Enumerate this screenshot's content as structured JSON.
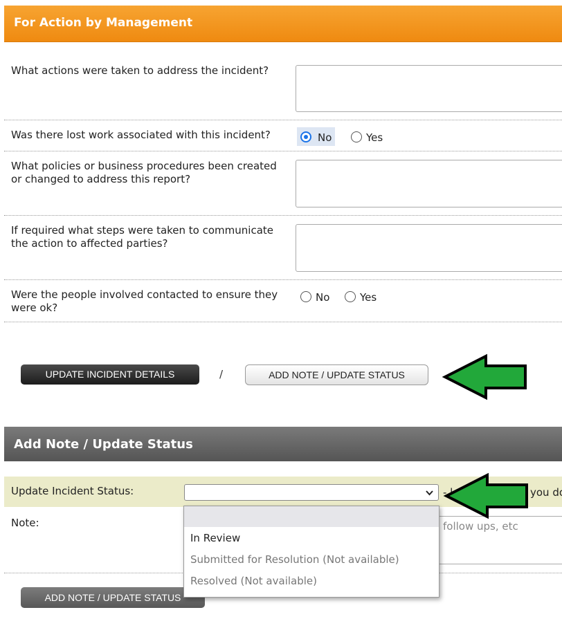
{
  "management": {
    "header": "For Action by Management",
    "q_actions": "What actions were taken to address the incident?",
    "q_lost_work": "Was there lost work associated with this incident?",
    "lost_work_selected": "No",
    "no_label": "No",
    "yes_label": "Yes",
    "q_policies_line1": "What policies or business procedures been created",
    "q_policies_line2": "or changed to address this report?",
    "q_communicate_line1": "If required what steps were taken to communicate",
    "q_communicate_line2": "the action to affected parties?",
    "q_contacted_line1": "Were the people involved contacted to ensure they",
    "q_contacted_line2": "were ok?"
  },
  "actions": {
    "update_details": "UPDATE INCIDENT DETAILS",
    "separator": "/",
    "add_note": "ADD NOTE / UPDATE STATUS"
  },
  "note_section": {
    "header": "Add Note / Update Status",
    "status_label": "Update Incident Status:",
    "status_value": "",
    "hint_left": "- l",
    "hint_right": "you do",
    "note_label": "Note:",
    "note_hint": "follow ups, etc",
    "options": [
      "",
      "In Review",
      "Submitted for Resolution (Not available)",
      "Resolved (Not available)"
    ],
    "submit_label": "ADD NOTE / UPDATE STATUS"
  },
  "colors": {
    "orange_header": "#ef8a10",
    "gray_header": "#555555",
    "status_row_bg": "#ebebc9",
    "arrow_green": "#22a83a",
    "radio_selected": "#1a73e8"
  }
}
